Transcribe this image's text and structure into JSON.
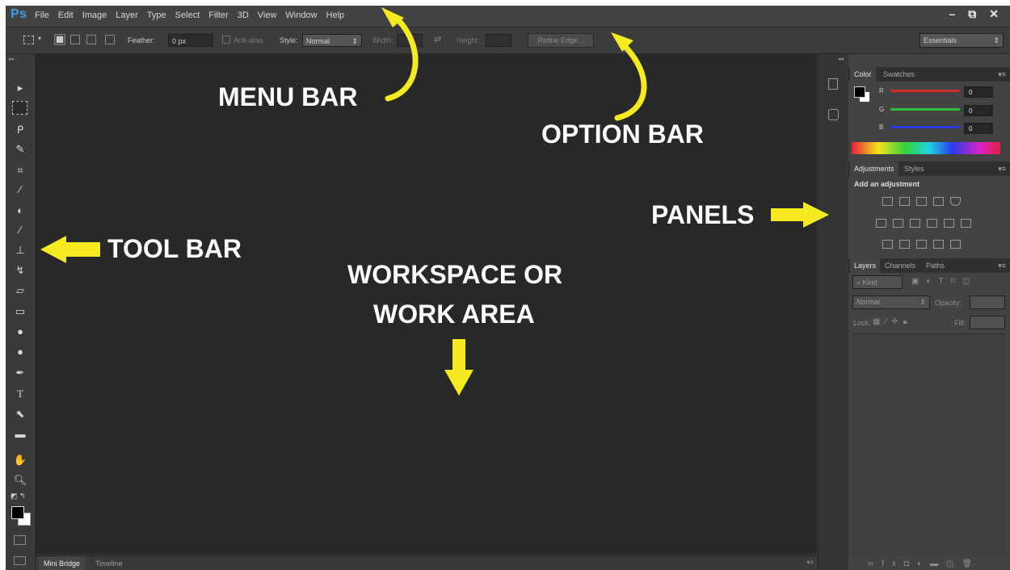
{
  "app": {
    "logo": "Ps"
  },
  "menu": [
    "File",
    "Edit",
    "Image",
    "Layer",
    "Type",
    "Select",
    "Filter",
    "3D",
    "View",
    "Window",
    "Help"
  ],
  "window_controls": {
    "minimize": "–",
    "restore": "⧉",
    "close": "✕"
  },
  "options": {
    "feather_label": "Feather:",
    "feather_value": "0 px",
    "antialias_label": "Anti-alias",
    "style_label": "Style:",
    "style_value": "Normal",
    "width_label": "Width:",
    "height_label": "Height:",
    "refine_edge": "Refine Edge...",
    "workspace_preset": "Essentials"
  },
  "panels": {
    "color_tabs": [
      "Color",
      "Swatches"
    ],
    "rgb": [
      {
        "label": "R",
        "value": "0",
        "color": "#d42a2a"
      },
      {
        "label": "G",
        "value": "0",
        "color": "#2ec43a"
      },
      {
        "label": "B",
        "value": "0",
        "color": "#2a3be0"
      }
    ],
    "adjust_tabs": [
      "Adjustments",
      "Styles"
    ],
    "adjust_title": "Add an adjustment",
    "layers_tabs": [
      "Layers",
      "Channels",
      "Paths"
    ],
    "kind_label": "Kind",
    "blend_mode": "Normal",
    "opacity_label": "Opacity:",
    "lock_label": "Lock:",
    "fill_label": "Fill:"
  },
  "bottom_tabs": [
    "Mini Bridge",
    "Timeline"
  ],
  "annotations": {
    "menu_bar": "MENU BAR",
    "option_bar": "OPTION BAR",
    "panels": "PANELS",
    "tool_bar": "TOOL BAR",
    "workspace_line1": "WORKSPACE OR",
    "workspace_line2": "WORK AREA"
  },
  "colors": {
    "arrow": "#f5ea1f",
    "ps_logo": "#3aa0ee"
  }
}
